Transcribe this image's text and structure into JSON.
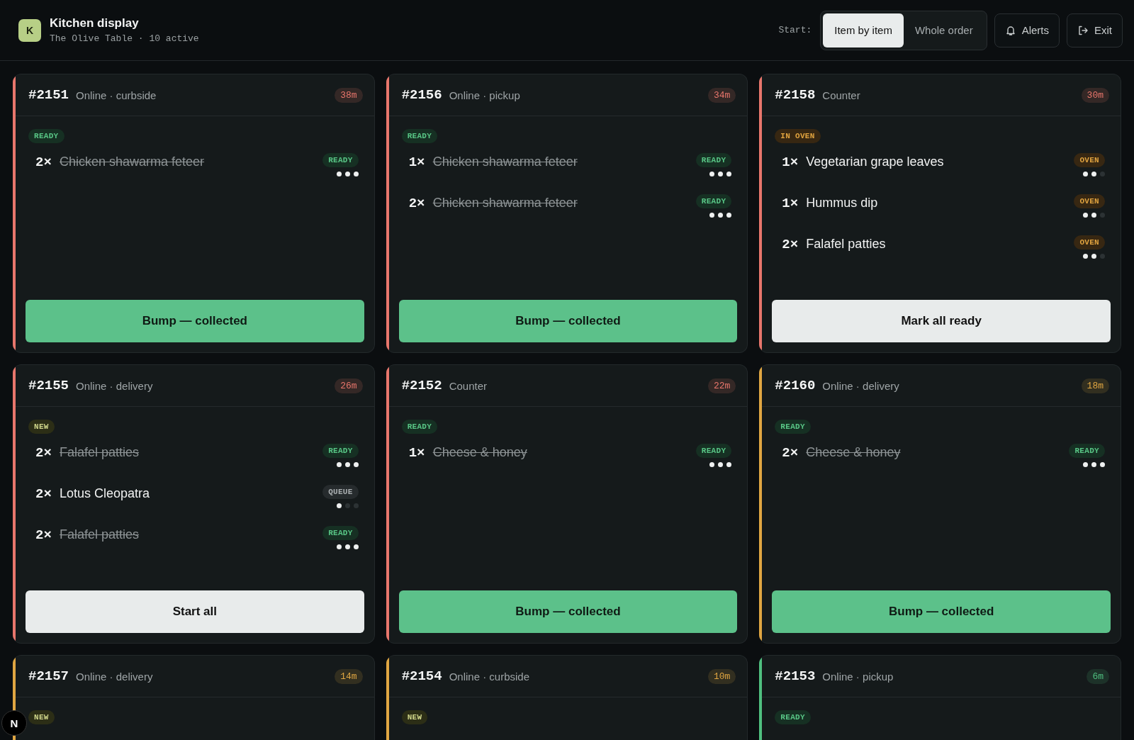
{
  "header": {
    "logo": "K",
    "title": "Kitchen display",
    "subtitle": "The Olive Table · 10 active",
    "start_label": "Start:",
    "modes": [
      {
        "label": "Item by item",
        "selected": true
      },
      {
        "label": "Whole order",
        "selected": false
      }
    ],
    "buttons": [
      {
        "label": "Alerts",
        "kind": "alerts"
      },
      {
        "label": "Exit",
        "kind": "exit"
      }
    ]
  },
  "orders": [
    {
      "number": "#2151",
      "channel": "Online · curbside",
      "age": "38m",
      "color": "#e8766c",
      "status": {
        "label": "READY",
        "kind": "ready"
      },
      "items": [
        {
          "qty": "2×",
          "name": "Chicken shawarma feteer",
          "done": true,
          "state": {
            "label": "READY",
            "kind": "ready"
          },
          "stars": 3
        }
      ],
      "action": {
        "label": "Bump — collected",
        "kind": "bump"
      }
    },
    {
      "number": "#2156",
      "channel": "Online · pickup",
      "age": "34m",
      "color": "#e8766c",
      "status": {
        "label": "READY",
        "kind": "ready"
      },
      "items": [
        {
          "qty": "1×",
          "name": "Chicken shawarma feteer",
          "done": true,
          "state": {
            "label": "READY",
            "kind": "ready"
          },
          "stars": 3
        },
        {
          "qty": "2×",
          "name": "Chicken shawarma feteer",
          "done": true,
          "state": {
            "label": "READY",
            "kind": "ready"
          },
          "stars": 3
        }
      ],
      "action": {
        "label": "Bump — collected",
        "kind": "bump"
      }
    },
    {
      "number": "#2158",
      "channel": "Counter",
      "age": "30m",
      "color": "#e8766c",
      "status": {
        "label": "IN OVEN",
        "kind": "oven"
      },
      "items": [
        {
          "qty": "1×",
          "name": "Vegetarian grape leaves",
          "done": false,
          "state": {
            "label": "OVEN",
            "kind": "oven"
          },
          "stars": 2
        },
        {
          "qty": "1×",
          "name": "Hummus dip",
          "done": false,
          "state": {
            "label": "OVEN",
            "kind": "oven"
          },
          "stars": 2
        },
        {
          "qty": "2×",
          "name": "Falafel patties",
          "done": false,
          "state": {
            "label": "OVEN",
            "kind": "oven"
          },
          "stars": 2
        }
      ],
      "action": {
        "label": "Mark all ready",
        "kind": "plain"
      }
    },
    {
      "number": "#2155",
      "channel": "Online · delivery",
      "age": "26m",
      "color": "#e8766c",
      "status": {
        "label": "NEW",
        "kind": "new"
      },
      "items": [
        {
          "qty": "2×",
          "name": "Falafel patties",
          "done": true,
          "state": {
            "label": "READY",
            "kind": "ready"
          },
          "stars": 3
        },
        {
          "qty": "2×",
          "name": "Lotus Cleopatra",
          "done": false,
          "state": {
            "label": "QUEUE",
            "kind": "queue"
          },
          "stars": 1
        },
        {
          "qty": "2×",
          "name": "Falafel patties",
          "done": true,
          "state": {
            "label": "READY",
            "kind": "ready"
          },
          "stars": 3
        }
      ],
      "action": {
        "label": "Start all",
        "kind": "plain"
      }
    },
    {
      "number": "#2152",
      "channel": "Counter",
      "age": "22m",
      "color": "#e8766c",
      "status": {
        "label": "READY",
        "kind": "ready"
      },
      "items": [
        {
          "qty": "1×",
          "name": "Cheese & honey",
          "done": true,
          "state": {
            "label": "READY",
            "kind": "ready"
          },
          "stars": 3
        }
      ],
      "action": {
        "label": "Bump — collected",
        "kind": "bump"
      }
    },
    {
      "number": "#2160",
      "channel": "Online · delivery",
      "age": "18m",
      "color": "#e0a642",
      "status": {
        "label": "READY",
        "kind": "ready"
      },
      "items": [
        {
          "qty": "2×",
          "name": "Cheese & honey",
          "done": true,
          "state": {
            "label": "READY",
            "kind": "ready"
          },
          "stars": 3
        }
      ],
      "action": {
        "label": "Bump — collected",
        "kind": "bump"
      }
    },
    {
      "number": "#2157",
      "channel": "Online · delivery",
      "age": "14m",
      "color": "#e0a642",
      "status": {
        "label": "NEW",
        "kind": "new"
      }
    },
    {
      "number": "#2154",
      "channel": "Online · curbside",
      "age": "10m",
      "color": "#e0a642",
      "status": {
        "label": "NEW",
        "kind": "new"
      }
    },
    {
      "number": "#2153",
      "channel": "Online · pickup",
      "age": "6m",
      "color": "#4fbf7f",
      "status": {
        "label": "READY",
        "kind": "ready"
      }
    }
  ],
  "dev_badge": {
    "label": "N"
  }
}
